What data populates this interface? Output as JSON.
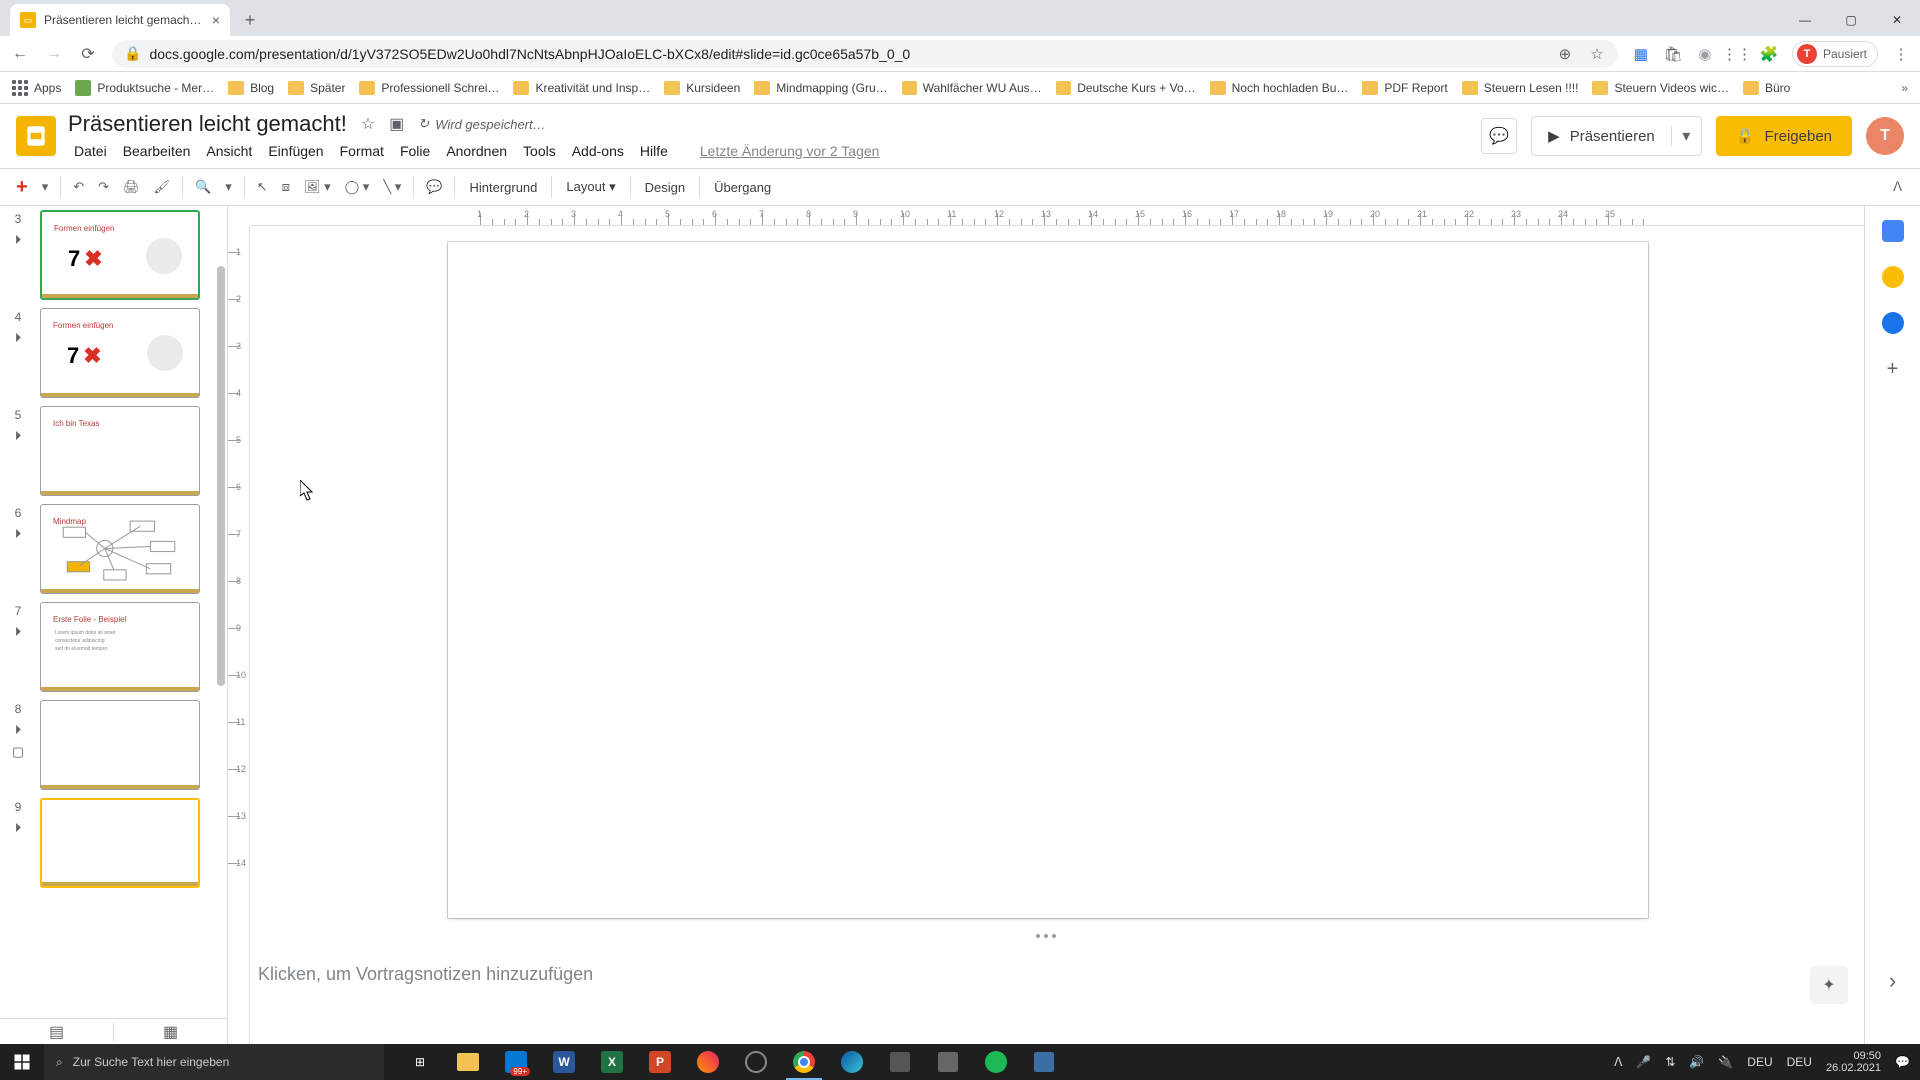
{
  "browser": {
    "tab_title": "Präsentieren leicht gemacht! - G…",
    "url": "docs.google.com/presentation/d/1yV372SO5EDw2Uo0hdl7NcNtsAbnpHJOaIoELC-bXCx8/edit#slide=id.gc0ce65a57b_0_0",
    "pausiert": "Pausiert",
    "bookmarks": [
      "Apps",
      "Produktsuche - Mer…",
      "Blog",
      "Später",
      "Professionell Schrei…",
      "Kreativität und Insp…",
      "Kursideen",
      "Mindmapping (Gru…",
      "Wahlfächer WU Aus…",
      "Deutsche Kurs + Vo…",
      "Noch hochladen Bu…",
      "PDF Report",
      "Steuern Lesen !!!!",
      "Steuern Videos wic…",
      "Büro"
    ]
  },
  "doc": {
    "title": "Präsentieren leicht gemacht!",
    "saving": "Wird gespeichert…",
    "last_change": "Letzte Änderung vor 2 Tagen"
  },
  "menus": [
    "Datei",
    "Bearbeiten",
    "Ansicht",
    "Einfügen",
    "Format",
    "Folie",
    "Anordnen",
    "Tools",
    "Add-ons",
    "Hilfe"
  ],
  "header_buttons": {
    "present": "Präsentieren",
    "share": "Freigeben"
  },
  "toolbar_text": {
    "background": "Hintergrund",
    "layout": "Layout",
    "design": "Design",
    "transition": "Übergang"
  },
  "ruler_h": [
    1,
    2,
    3,
    4,
    5,
    6,
    7,
    8,
    9,
    10,
    11,
    12,
    13,
    14,
    15,
    16,
    17,
    18,
    19,
    20,
    21,
    22,
    23,
    24,
    25
  ],
  "ruler_v": [
    1,
    2,
    3,
    4,
    5,
    6,
    7,
    8,
    9,
    10,
    11,
    12,
    13,
    14
  ],
  "slides": [
    {
      "num": 3,
      "title": "Formen einfügen",
      "big": "7",
      "active": true
    },
    {
      "num": 4,
      "title": "Formen einfügen",
      "big": "7"
    },
    {
      "num": 5,
      "title": "Ich bin Texas"
    },
    {
      "num": 6,
      "title": "Mindmap",
      "mindmap": true
    },
    {
      "num": 7,
      "title": "Erste Folie - Beispiel",
      "example": true
    },
    {
      "num": 8,
      "blank": true
    },
    {
      "num": 9,
      "blank": true,
      "selected": true
    }
  ],
  "notes_placeholder": "Klicken, um Vortragsnotizen hinzuzufügen",
  "taskbar": {
    "search_placeholder": "Zur Suche Text hier eingeben",
    "badge": "99+",
    "lang1": "DEU",
    "lang2": "DEU",
    "time": "09:50",
    "date": "26.02.2021"
  }
}
